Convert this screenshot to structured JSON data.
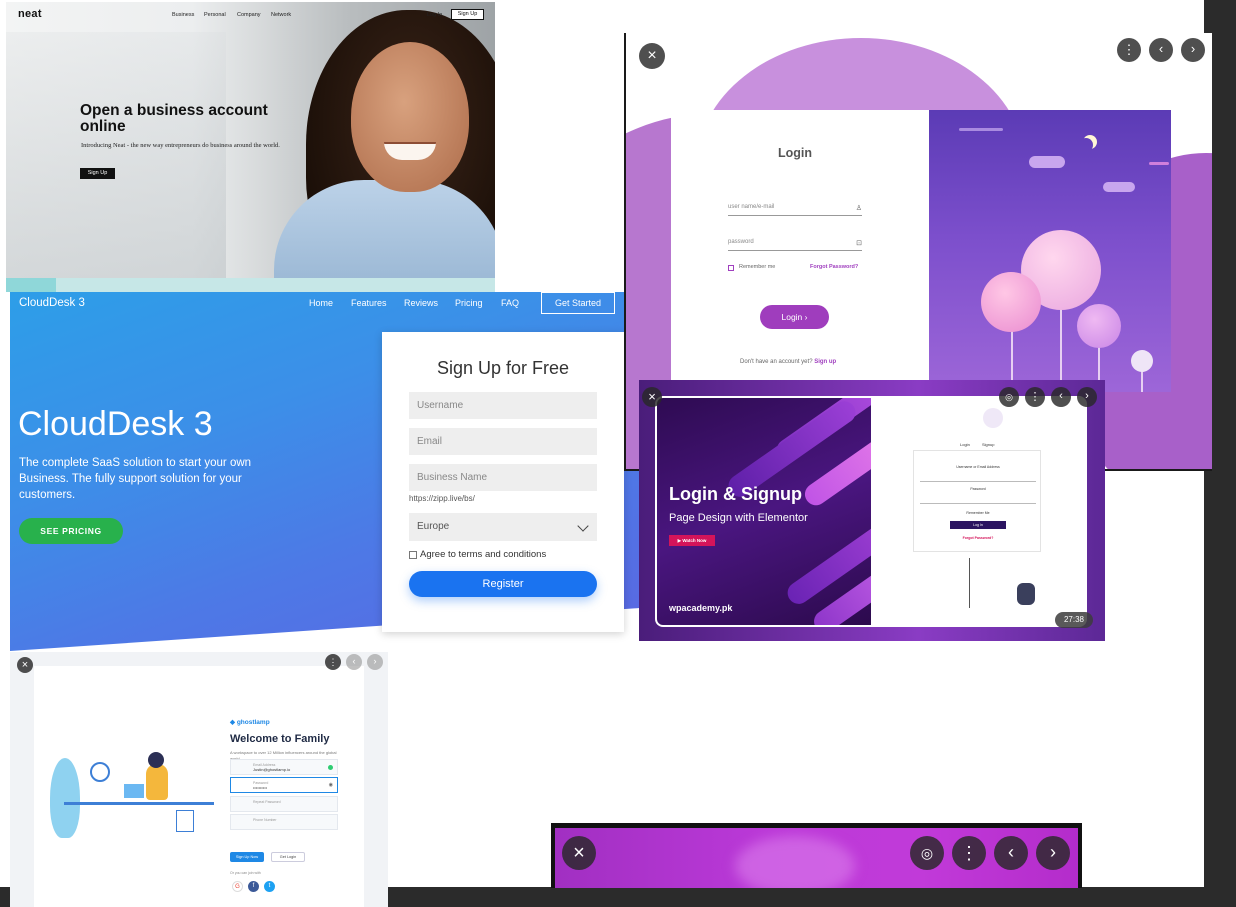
{
  "neat": {
    "logo": "neat",
    "nav": [
      "Business",
      "Personal",
      "Company",
      "Network"
    ],
    "login": "Log In",
    "signup": "Sign Up",
    "headline": "Open a business account online",
    "subtext": "Introducing Neat - the new way entrepreneurs do business around the world.",
    "cta": "Sign Up"
  },
  "clouddesk": {
    "logo": "CloudDesk 3",
    "nav": [
      "Home",
      "Features",
      "Reviews",
      "Pricing",
      "FAQ"
    ],
    "get_started": "Get Started",
    "title": "CloudDesk 3",
    "description": "The complete SaaS solution to start your own Business. The fully support solution for your customers.",
    "cta": "SEE PRICING",
    "form": {
      "title": "Sign Up for Free",
      "username_placeholder": "Username",
      "email_placeholder": "Email",
      "business_placeholder": "Business Name",
      "url_hint": "https://zipp.live/bs/",
      "region": "Europe",
      "agree": "Agree to terms and conditions",
      "register": "Register"
    },
    "colors": {
      "accent": "#1a73f0",
      "cta": "#28b14c"
    }
  },
  "purple_login": {
    "title": "Login",
    "user_placeholder": "user name/e-mail",
    "password_placeholder": "password",
    "remember": "Remember me",
    "forgot": "Forgot Password?",
    "login_button": "Login",
    "no_account": "Don't have an account yet?",
    "signup_link": "Sign up",
    "colors": {
      "accent": "#9f3dbd"
    }
  },
  "elementor": {
    "title": "Login & Signup",
    "subtitle": "Page Design with Elementor",
    "watch": "Watch Now",
    "brand": "wpacademy.pk",
    "tabs": [
      "Login",
      "Signup"
    ],
    "field1": "Username or Email Address",
    "field2": "Password",
    "remember": "Remember Me",
    "login_button": "Log In",
    "forgot": "Forgot Password?",
    "duration": "27:38"
  },
  "ghostlamp": {
    "brand": "ghostlamp",
    "title": "Welcome to Family",
    "description": "A workspace to over 12 Million influencers around the global world.",
    "email_label": "Email Address",
    "email_value": "Justin@ghostlamp.io",
    "password_label": "Password",
    "password_value": "••••••••••",
    "repeat_password": "Repeat Password",
    "phone": "Phone Number",
    "signup_button": "Sign Up Now",
    "login_button": "Get Login",
    "social_hint": "Or you can join with",
    "social": [
      "G",
      "f",
      "t"
    ]
  },
  "viewer": {
    "icons": [
      "close-icon",
      "more-icon",
      "prev-icon",
      "next-icon",
      "fullscreen-icon"
    ]
  }
}
